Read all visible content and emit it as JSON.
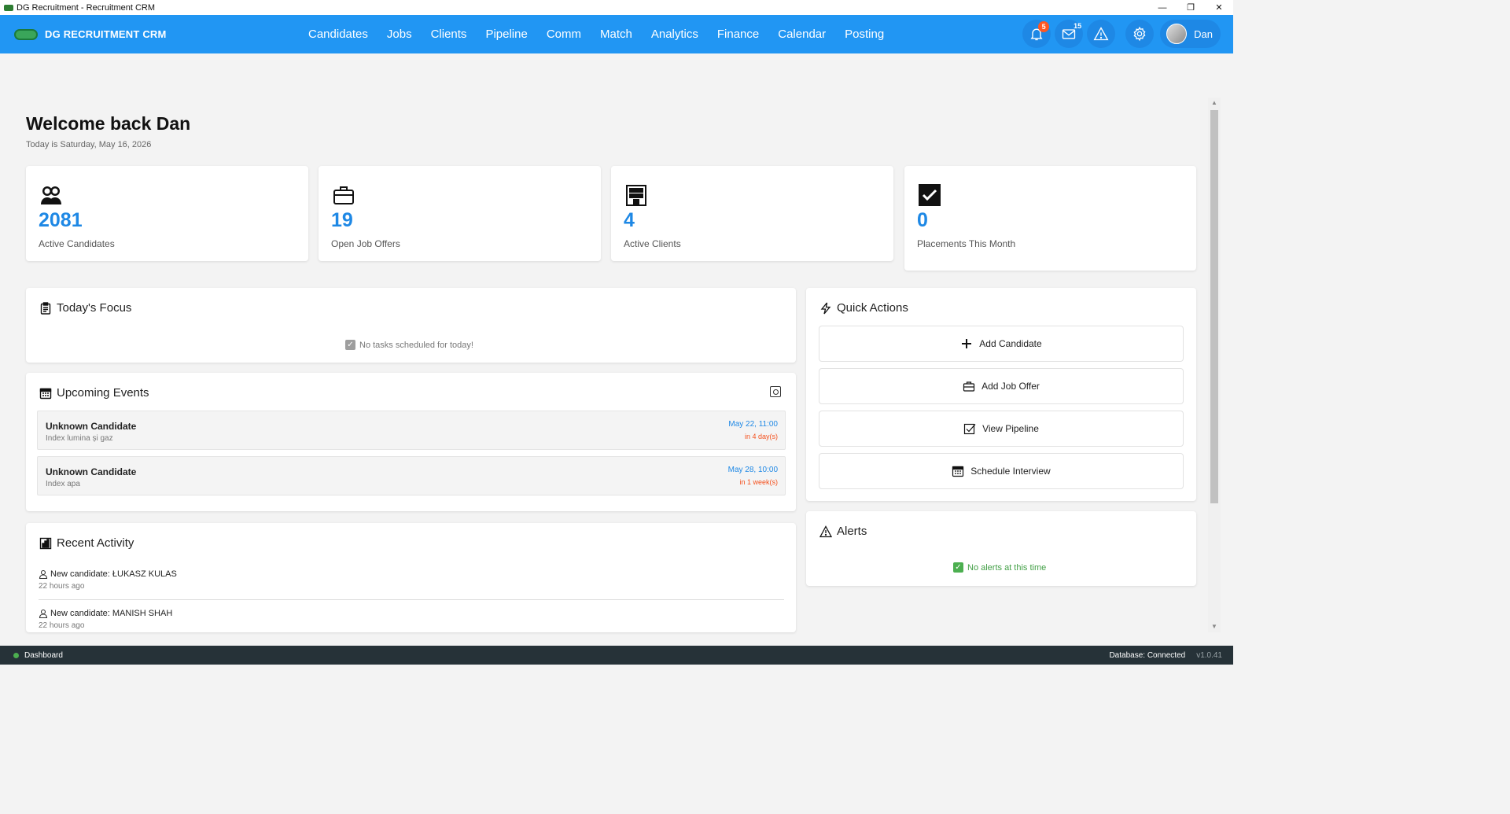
{
  "window": {
    "title": "DG Recruitment - Recruitment CRM",
    "controls": {
      "minimize": "—",
      "restore": "❐",
      "close": "✕"
    }
  },
  "navbar": {
    "brand": "DG RECRUITMENT CRM",
    "menu": [
      "Candidates",
      "Jobs",
      "Clients",
      "Pipeline",
      "Comm",
      "Match",
      "Analytics",
      "Finance",
      "Calendar",
      "Posting"
    ],
    "notifications_count": "5",
    "messages_count": "15",
    "user_name": "Dan",
    "accent_color": "#2196f3"
  },
  "welcome": {
    "title": "Welcome back  Dan",
    "date": "Today is Saturday, May 16, 2026"
  },
  "stats": [
    {
      "icon": "users-icon",
      "value": "2081",
      "label": "Active Candidates"
    },
    {
      "icon": "briefcase-icon",
      "value": "19",
      "label": "Open Job Offers"
    },
    {
      "icon": "building-icon",
      "value": "4",
      "label": "Active Clients"
    },
    {
      "icon": "check-icon",
      "value": "0",
      "label": "Placements This Month"
    }
  ],
  "todays_focus": {
    "title": "Today's Focus",
    "empty": "No tasks scheduled for today!"
  },
  "upcoming_events": {
    "title": "Upcoming Events",
    "items": [
      {
        "name": "Unknown Candidate",
        "desc": "Index lumina și gaz",
        "date": "May 22, 11:00",
        "relative": "in 4 day(s)"
      },
      {
        "name": "Unknown Candidate",
        "desc": "Index apa",
        "date": "May 28, 10:00",
        "relative": "in 1 week(s)"
      }
    ]
  },
  "recent_activity": {
    "title": "Recent Activity",
    "items": [
      {
        "text": "New candidate: ŁUKASZ KULAS",
        "time": "22 hours ago"
      },
      {
        "text": "New candidate: MANISH SHAH",
        "time": "22 hours ago"
      }
    ]
  },
  "quick_actions": {
    "title": "Quick Actions",
    "buttons": [
      "Add Candidate",
      "Add Job Offer",
      "View Pipeline",
      "Schedule Interview"
    ]
  },
  "alerts": {
    "title": "Alerts",
    "empty": "No alerts at this time"
  },
  "statusbar": {
    "page": "Dashboard",
    "db_status": "Database: Connected",
    "version": "v1.0.41"
  }
}
